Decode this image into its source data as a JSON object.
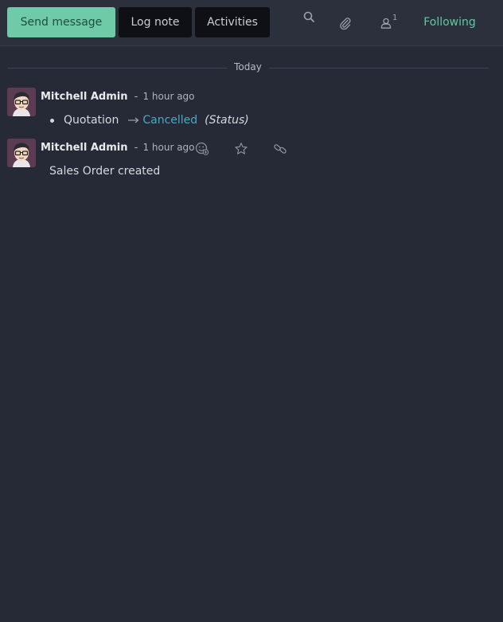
{
  "toolbar": {
    "send_message_label": "Send message",
    "log_note_label": "Log note",
    "activities_label": "Activities",
    "search_icon": "search-icon",
    "attachment_icon": "paperclip-icon",
    "follower_icon": "user-icon",
    "follower_count": "1",
    "following_label": "Following"
  },
  "colors": {
    "accent": "#6fcaa7",
    "following": "#5fc9a1",
    "tracking_value": "#4da7c4",
    "background": "#262a36"
  },
  "thread": {
    "date_separator": "Today",
    "messages": [
      {
        "author": "Mitchell Admin",
        "separator": "-",
        "time": "1 hour ago",
        "tracking": {
          "old_value": "Quotation",
          "new_value": "Cancelled",
          "field": "(Status)"
        }
      },
      {
        "author": "Mitchell Admin",
        "separator": "-",
        "time": "1 hour ago",
        "body": "Sales Order created",
        "actions": [
          "add-reaction-icon",
          "star-icon",
          "link-icon"
        ]
      }
    ]
  }
}
